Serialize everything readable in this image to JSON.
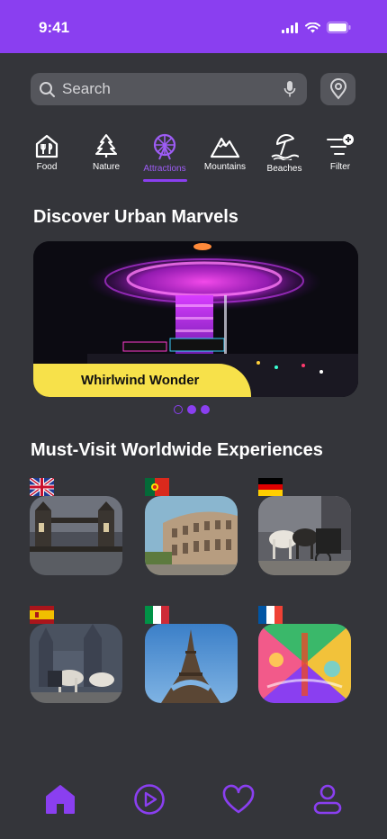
{
  "status_bar": {
    "time": "9:41"
  },
  "search": {
    "placeholder": "Search"
  },
  "categories": [
    {
      "label": "Food",
      "icon": "food-icon"
    },
    {
      "label": "Nature",
      "icon": "tree-icon"
    },
    {
      "label": "Attractions",
      "icon": "ferris-wheel-icon",
      "active": true
    },
    {
      "label": "Mountains",
      "icon": "mountain-icon"
    },
    {
      "label": "Beaches",
      "icon": "beach-umbrella-icon"
    },
    {
      "label": "Filter",
      "icon": "filter-icon"
    }
  ],
  "featured": {
    "title": "Discover Urban Marvels",
    "card_label": "Whirlwind Wonder",
    "carousel": {
      "count": 3,
      "active_index": 0
    }
  },
  "experiences": {
    "title": "Must-Visit Worldwide Experiences",
    "items": [
      {
        "country": "United Kingdom",
        "flag": "uk-flag",
        "photo": "tower-bridge"
      },
      {
        "country": "Portugal",
        "flag": "portugal-flag",
        "photo": "colosseum"
      },
      {
        "country": "Germany",
        "flag": "germany-flag",
        "photo": "horse-carriage"
      },
      {
        "country": "Spain",
        "flag": "spain-flag",
        "photo": "cathedral-carriage"
      },
      {
        "country": "Italy",
        "flag": "italy-flag",
        "photo": "eiffel-tower"
      },
      {
        "country": "France",
        "flag": "france-flag",
        "photo": "colorful-street-art"
      }
    ]
  },
  "bottom_nav": [
    {
      "name": "home",
      "icon": "home-icon",
      "active": true
    },
    {
      "name": "play",
      "icon": "play-icon"
    },
    {
      "name": "favorites",
      "icon": "heart-icon"
    },
    {
      "name": "profile",
      "icon": "user-icon"
    }
  ],
  "colors": {
    "accent": "#8a3ff0",
    "background": "#34353a",
    "highlight": "#f7e14a"
  }
}
